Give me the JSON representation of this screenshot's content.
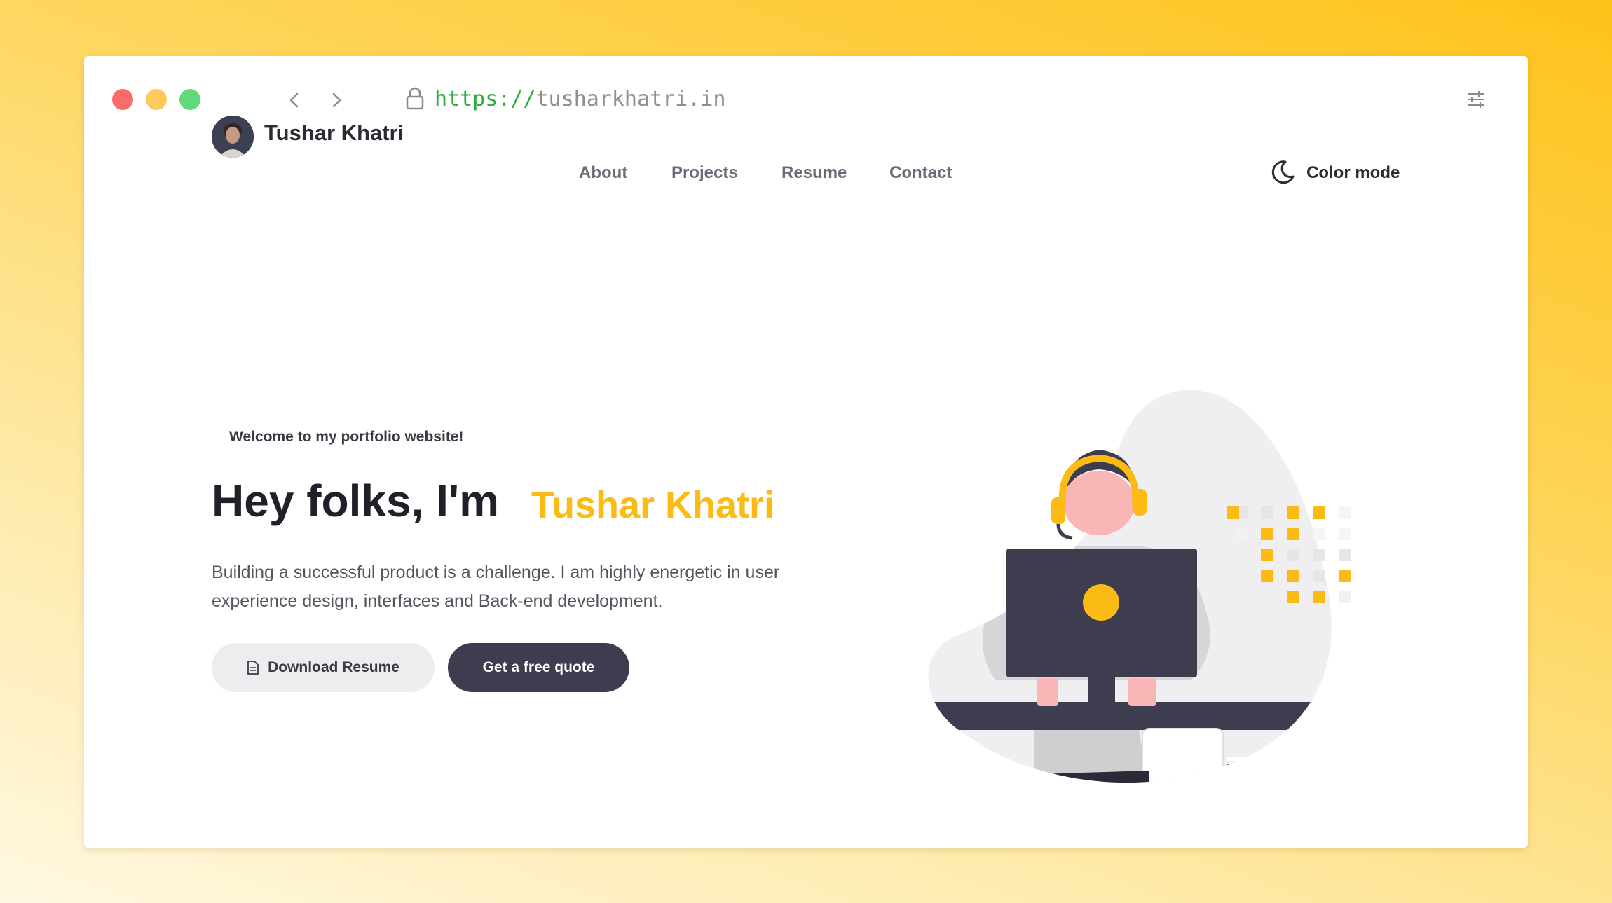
{
  "browser": {
    "url_scheme": "https://",
    "url_host": "tusharkhatri.in"
  },
  "site": {
    "brand_name": "Tushar Khatri",
    "nav": [
      "About",
      "Projects",
      "Resume",
      "Contact"
    ],
    "color_mode_label": "Color mode"
  },
  "hero": {
    "welcome": "Welcome to my portfolio website!",
    "headline": "Hey folks, I'm",
    "name": "Tushar Khatri",
    "intro_line1": "Building a successful product is a challenge. I am highly energetic in user",
    "intro_line2": "experience design, interfaces and Back-end development.",
    "download_label": "Download Resume",
    "quote_label": "Get a free quote"
  },
  "colors": {
    "accent": "#fbbb14",
    "dark": "#3e3c4f",
    "background_top": "#fec21a",
    "background_bottom": "#fff8e2"
  }
}
